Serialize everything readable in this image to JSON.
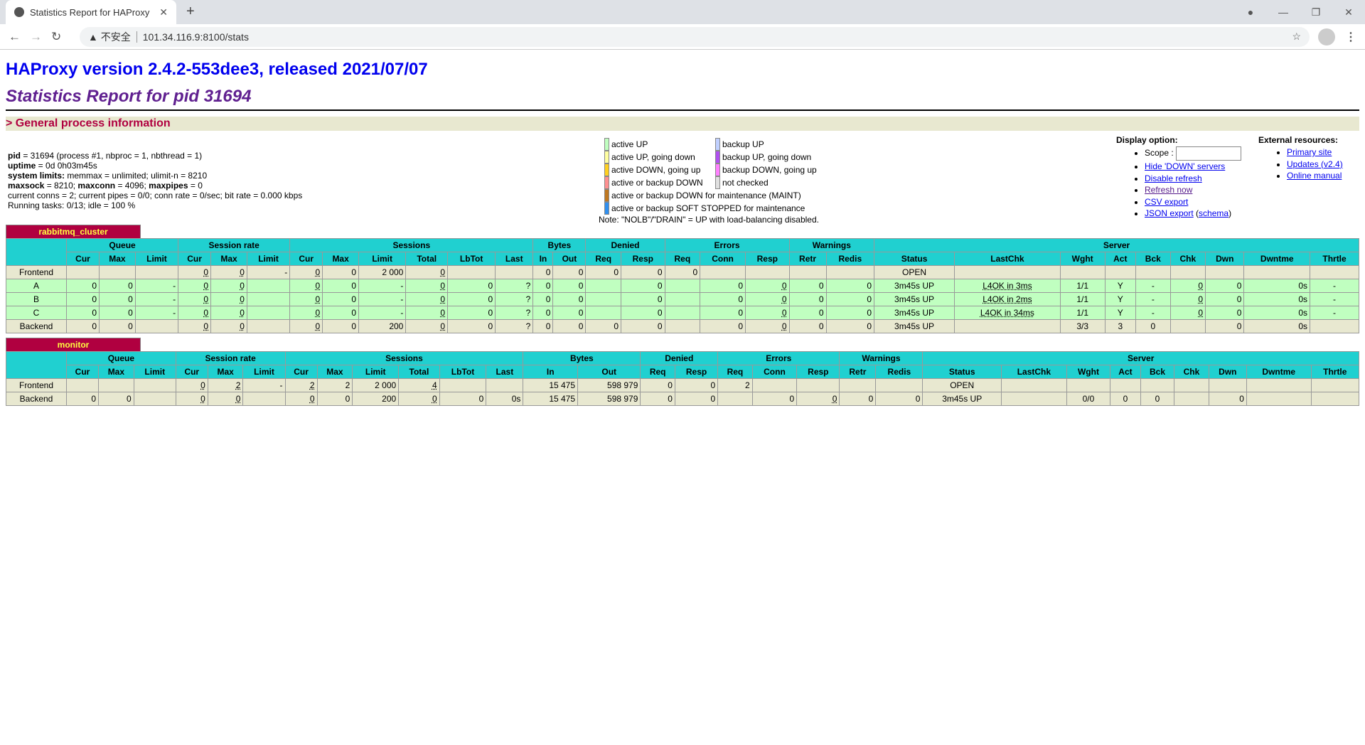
{
  "browser": {
    "tab_title": "Statistics Report for HAProxy",
    "security": "不安全",
    "url": "101.34.116.9:8100/stats"
  },
  "header": {
    "title": "HAProxy version 2.4.2-553dee3, released 2021/07/07",
    "subtitle": "Statistics Report for pid 31694",
    "section": "> General process information"
  },
  "process": {
    "lines": [
      {
        "b": "pid",
        "t": " = 31694 (process #1, nbproc = 1, nbthread = 1)"
      },
      {
        "b": "uptime",
        "t": " = 0d 0h03m45s"
      },
      {
        "b": "system limits:",
        "t": " memmax = unlimited; ulimit-n = 8210"
      },
      {
        "b": "maxsock",
        "t": " = 8210; ",
        "b2": "maxconn",
        "t2": " = 4096; ",
        "b3": "maxpipes",
        "t3": " = 0"
      },
      {
        "b": "",
        "t": "current conns = 2; current pipes = 0/0; conn rate = 0/sec; bit rate = 0.000 kbps"
      },
      {
        "b": "",
        "t": "Running tasks: 0/13; idle = 100 %"
      }
    ]
  },
  "legend": {
    "col1": [
      {
        "label": "active UP",
        "color": "#c0ffc0"
      },
      {
        "label": "active UP, going down",
        "color": "#ffffa0"
      },
      {
        "label": "active DOWN, going up",
        "color": "#ffd020"
      },
      {
        "label": "active or backup DOWN",
        "color": "#ff9090"
      },
      {
        "label": "active or backup DOWN for maintenance (MAINT)",
        "color": "#c07820"
      },
      {
        "label": "active or backup SOFT STOPPED for maintenance",
        "color": "#3090f0"
      }
    ],
    "col2": [
      {
        "label": "backup UP",
        "color": "#c0d0ff"
      },
      {
        "label": "backup UP, going down",
        "color": "#b050f0"
      },
      {
        "label": "backup DOWN, going up",
        "color": "#ff80ff"
      },
      {
        "label": "not checked",
        "color": "#e0e0e0"
      }
    ],
    "note": "Note: \"NOLB\"/\"DRAIN\" = UP with load-balancing disabled."
  },
  "display": {
    "title": "Display option:",
    "scope_label": "Scope :",
    "scope_value": "",
    "links": [
      "Hide 'DOWN' servers",
      "Disable refresh",
      "Refresh now",
      "CSV export"
    ],
    "json_export": "JSON export",
    "schema": "schema"
  },
  "external": {
    "title": "External resources:",
    "links": [
      "Primary site",
      "Updates (v2.4)",
      "Online manual"
    ]
  },
  "table_groups": [
    [
      "",
      "1"
    ],
    [
      "Queue",
      "3"
    ],
    [
      "Session rate",
      "3"
    ],
    [
      "Sessions",
      "6"
    ],
    [
      "Bytes",
      "2"
    ],
    [
      "Denied",
      "2"
    ],
    [
      "Errors",
      "3"
    ],
    [
      "Warnings",
      "2"
    ],
    [
      "Server",
      "9"
    ]
  ],
  "table_columns": [
    "Cur",
    "Max",
    "Limit",
    "Cur",
    "Max",
    "Limit",
    "Cur",
    "Max",
    "Limit",
    "Total",
    "LbTot",
    "Last",
    "In",
    "Out",
    "Req",
    "Resp",
    "Req",
    "Conn",
    "Resp",
    "Retr",
    "Redis",
    "Status",
    "LastChk",
    "Wght",
    "Act",
    "Bck",
    "Chk",
    "Dwn",
    "Dwntme",
    "Thrtle"
  ],
  "proxies": [
    {
      "name": "rabbitmq_cluster",
      "rows": [
        {
          "type": "fe",
          "cells": [
            "Frontend",
            "",
            "",
            "",
            "0",
            "0",
            "-",
            "0",
            "0",
            "2 000",
            "0",
            "",
            "",
            "0",
            "0",
            "0",
            "0",
            "0",
            "",
            "",
            "",
            "",
            "OPEN",
            "",
            "",
            "",
            "",
            "",
            "",
            "",
            ""
          ]
        },
        {
          "type": "sv",
          "cells": [
            "A",
            "0",
            "0",
            "-",
            "0",
            "0",
            "",
            "0",
            "0",
            "-",
            "0",
            "0",
            "?",
            "0",
            "0",
            "",
            "0",
            "",
            "0",
            "0",
            "0",
            "0",
            "3m45s UP",
            "L4OK in 3ms",
            "1/1",
            "Y",
            "-",
            "0",
            "0",
            "0s",
            "-"
          ]
        },
        {
          "type": "sv",
          "cells": [
            "B",
            "0",
            "0",
            "-",
            "0",
            "0",
            "",
            "0",
            "0",
            "-",
            "0",
            "0",
            "?",
            "0",
            "0",
            "",
            "0",
            "",
            "0",
            "0",
            "0",
            "0",
            "3m45s UP",
            "L4OK in 2ms",
            "1/1",
            "Y",
            "-",
            "0",
            "0",
            "0s",
            "-"
          ]
        },
        {
          "type": "sv",
          "cells": [
            "C",
            "0",
            "0",
            "-",
            "0",
            "0",
            "",
            "0",
            "0",
            "-",
            "0",
            "0",
            "?",
            "0",
            "0",
            "",
            "0",
            "",
            "0",
            "0",
            "0",
            "0",
            "3m45s UP",
            "L4OK in 34ms",
            "1/1",
            "Y",
            "-",
            "0",
            "0",
            "0s",
            "-"
          ]
        },
        {
          "type": "be",
          "cells": [
            "Backend",
            "0",
            "0",
            "",
            "0",
            "0",
            "",
            "0",
            "0",
            "200",
            "0",
            "0",
            "?",
            "0",
            "0",
            "0",
            "0",
            "",
            "0",
            "0",
            "0",
            "0",
            "3m45s UP",
            "",
            "3/3",
            "3",
            "0",
            "",
            "0",
            "0s",
            ""
          ]
        }
      ]
    },
    {
      "name": "monitor",
      "rows": [
        {
          "type": "fe",
          "cells": [
            "Frontend",
            "",
            "",
            "",
            "0",
            "2",
            "-",
            "2",
            "2",
            "2 000",
            "4",
            "",
            "",
            "15 475",
            "598 979",
            "0",
            "0",
            "2",
            "",
            "",
            "",
            "",
            "OPEN",
            "",
            "",
            "",
            "",
            "",
            "",
            "",
            ""
          ]
        },
        {
          "type": "be",
          "cells": [
            "Backend",
            "0",
            "0",
            "",
            "0",
            "0",
            "",
            "0",
            "0",
            "200",
            "0",
            "0",
            "0s",
            "15 475",
            "598 979",
            "0",
            "0",
            "",
            "0",
            "0",
            "0",
            "0",
            "3m45s UP",
            "",
            "0/0",
            "0",
            "0",
            "",
            "0",
            "",
            ""
          ]
        }
      ]
    }
  ]
}
